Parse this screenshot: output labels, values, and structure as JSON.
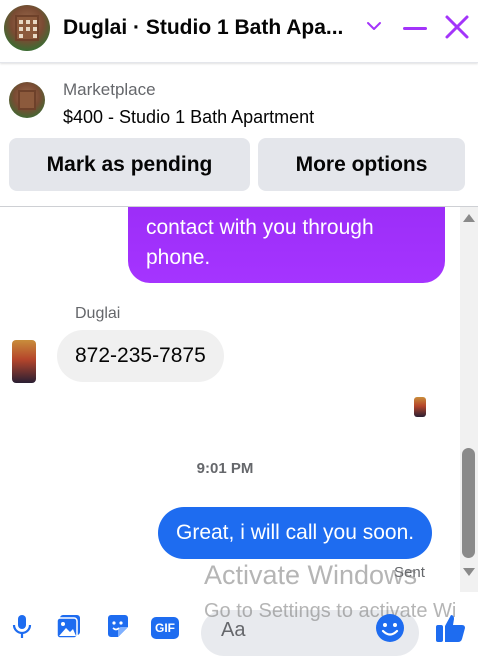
{
  "header": {
    "title": "Duglai · Studio 1 Bath Apa...",
    "avatar_icon": "building-avatar",
    "accent_color": "#a334fa"
  },
  "listing": {
    "source_label": "Marketplace",
    "title": "$400 - Studio 1 Bath Apartment"
  },
  "actions": {
    "pending_label": "Mark as pending",
    "more_label": "More options"
  },
  "messages": {
    "outgoing_partial": "contact with you through phone.",
    "sender_name": "Duglai",
    "incoming_text": "872-235-7875",
    "timestamp": "9:01 PM",
    "outgoing_text": "Great, i will call you soon.",
    "status": "Sent",
    "incoming_bubble_color": "#f0f0f0",
    "outgoing_bubble_color": "#1e6cf0"
  },
  "watermark": {
    "line1": "Activate Windows",
    "line2": "Go to Settings to activate Wi"
  },
  "composer": {
    "placeholder": "Aa",
    "gif_label": "GIF",
    "icon_color": "#1e6cf0"
  }
}
